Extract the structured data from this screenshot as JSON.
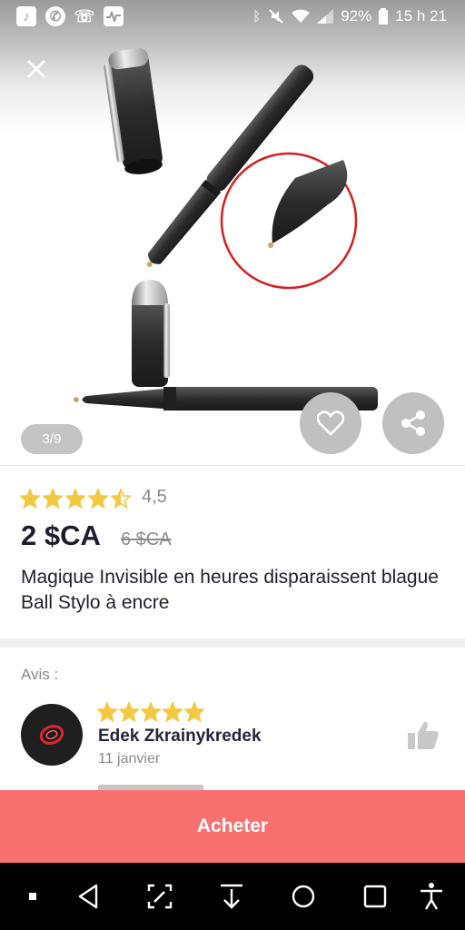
{
  "status_bar": {
    "battery": "92%",
    "time": "15 h 21",
    "left_icons": [
      "music-note-icon",
      "whatsapp-icon",
      "missed-call-icon",
      "activity-icon"
    ],
    "right_icons": [
      "bluetooth-icon",
      "mute-icon",
      "wifi-icon",
      "signal-icon",
      "battery-icon"
    ]
  },
  "gallery": {
    "pager": "3/9",
    "close_icon": "close-icon",
    "favorite_icon": "heart-icon",
    "share_icon": "share-icon"
  },
  "product": {
    "rating": "4,5",
    "stars": 4.5,
    "price": "2 $CA",
    "old_price": "6 $CA",
    "title": "Magique Invisible en heures disparaissent blague Ball Stylo à encre"
  },
  "reviews": {
    "label": "Avis :",
    "items": [
      {
        "name": "Edek Zkrainykredek",
        "date": "11 janvier",
        "stars": 5
      }
    ]
  },
  "buy_button": {
    "label": "Acheter"
  },
  "colors": {
    "accent": "#f8716f",
    "star": "#f5c842",
    "text_dark": "#1d1d2e",
    "muted": "#8a8a8a"
  },
  "nav_bar": {
    "icons": [
      "square-small-icon",
      "back-icon",
      "screenshot-edit-icon",
      "download-icon",
      "home-icon",
      "recents-icon",
      "accessibility-icon"
    ]
  }
}
